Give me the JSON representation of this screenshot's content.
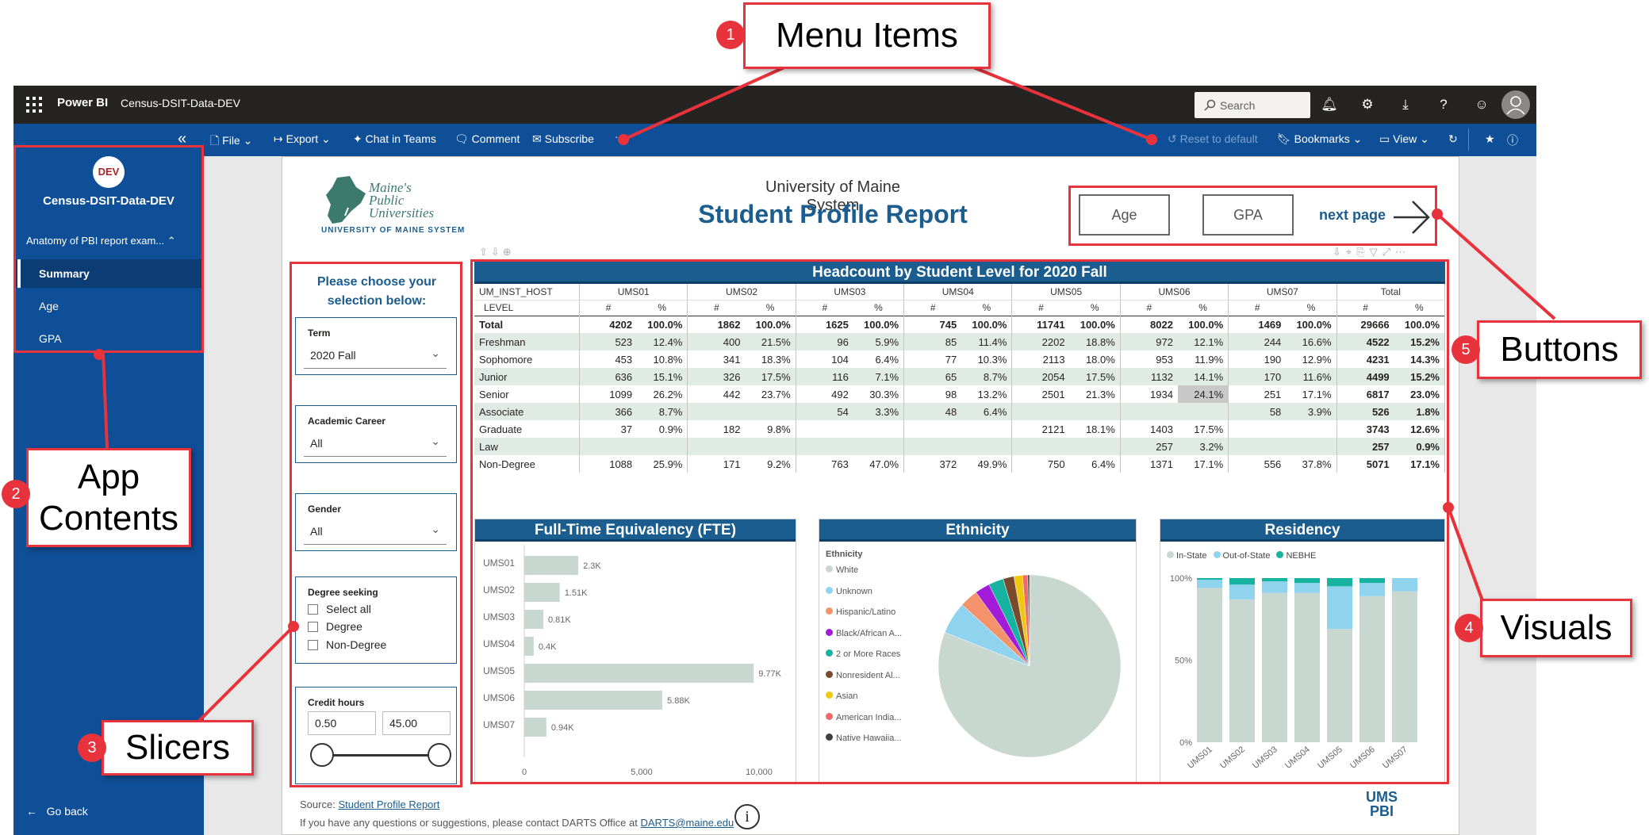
{
  "topbar": {
    "brand": "Power BI",
    "breadcrumb": "Census-DSIT-Data-DEV",
    "search_placeholder": "Search"
  },
  "commandbar": {
    "file": "File",
    "export": "Export",
    "chat_in_teams": "Chat in Teams",
    "comment": "Comment",
    "subscribe": "Subscribe",
    "more": "···",
    "reset": "Reset to default",
    "bookmarks": "Bookmarks",
    "view": "View"
  },
  "appnav": {
    "badge": "DEV",
    "title": "Census-DSIT-Data-DEV",
    "section": "Anatomy of PBI report exam...",
    "items": [
      "Summary",
      "Age",
      "GPA"
    ],
    "active": "Summary",
    "back": "Go back"
  },
  "report": {
    "logo_lines": [
      "Maine's",
      "Public",
      "Universities"
    ],
    "logo_sub": "UNIVERSITY OF MAINE SYSTEM",
    "subtitle": "University of Maine System",
    "title": "Student Profile Report",
    "buttons": {
      "age": "Age",
      "gpa": "GPA",
      "next": "next page"
    },
    "footer_source_label": "Source:",
    "footer_source_link": "Student Profile Report",
    "footer_contact": "If you have any questions or suggestions, please contact DARTS Office at",
    "footer_email": "DARTS@maine.edu",
    "corner_logo": [
      "UMS",
      "PBI"
    ]
  },
  "slicers": {
    "heading": "Please choose your selection below:",
    "term": {
      "label": "Term",
      "value": "2020 Fall"
    },
    "career": {
      "label": "Academic Career",
      "value": "All"
    },
    "gender": {
      "label": "Gender",
      "value": "All"
    },
    "degree": {
      "label": "Degree seeking",
      "options": [
        "Select all",
        "Degree",
        "Non-Degree"
      ]
    },
    "credit": {
      "label": "Credit hours",
      "min": "0.50",
      "max": "45.00"
    }
  },
  "matrix": {
    "title": "Headcount by Student Level for 2020 Fall",
    "corner_top": "UM_INST_HOST",
    "corner_bottom": "LEVEL",
    "groups": [
      "UMS01",
      "UMS02",
      "UMS03",
      "UMS04",
      "UMS05",
      "UMS06",
      "UMS07",
      "Total"
    ],
    "sub": [
      "#",
      "%"
    ],
    "rows": [
      {
        "level": "Total",
        "cells": [
          "4202",
          "100.0%",
          "1862",
          "100.0%",
          "1625",
          "100.0%",
          "745",
          "100.0%",
          "11741",
          "100.0%",
          "8022",
          "100.0%",
          "1469",
          "100.0%",
          "29666",
          "100.0%"
        ]
      },
      {
        "level": "Freshman",
        "cells": [
          "523",
          "12.4%",
          "400",
          "21.5%",
          "96",
          "5.9%",
          "85",
          "11.4%",
          "2202",
          "18.8%",
          "972",
          "12.1%",
          "244",
          "16.6%",
          "4522",
          "15.2%"
        ]
      },
      {
        "level": "Sophomore",
        "cells": [
          "453",
          "10.8%",
          "341",
          "18.3%",
          "104",
          "6.4%",
          "77",
          "10.3%",
          "2113",
          "18.0%",
          "953",
          "11.9%",
          "190",
          "12.9%",
          "4231",
          "14.3%"
        ]
      },
      {
        "level": "Junior",
        "cells": [
          "636",
          "15.1%",
          "326",
          "17.5%",
          "116",
          "7.1%",
          "65",
          "8.7%",
          "2054",
          "17.5%",
          "1132",
          "14.1%",
          "170",
          "11.6%",
          "4499",
          "15.2%"
        ]
      },
      {
        "level": "Senior",
        "cells": [
          "1099",
          "26.2%",
          "442",
          "23.7%",
          "492",
          "30.3%",
          "98",
          "13.2%",
          "2501",
          "21.3%",
          "1934",
          "24.1%",
          "251",
          "17.1%",
          "6817",
          "23.0%"
        ]
      },
      {
        "level": "Associate",
        "cells": [
          "366",
          "8.7%",
          "",
          "",
          "54",
          "3.3%",
          "48",
          "6.4%",
          "",
          "",
          "",
          "",
          "58",
          "3.9%",
          "526",
          "1.8%"
        ]
      },
      {
        "level": "Graduate",
        "cells": [
          "37",
          "0.9%",
          "182",
          "9.8%",
          "",
          "",
          "",
          "",
          "2121",
          "18.1%",
          "1403",
          "17.5%",
          "",
          "",
          "3743",
          "12.6%"
        ]
      },
      {
        "level": "Law",
        "cells": [
          "",
          "",
          "",
          "",
          "",
          "",
          "",
          "",
          "",
          "",
          "257",
          "3.2%",
          "",
          "",
          "257",
          "0.9%"
        ]
      },
      {
        "level": "Non-Degree",
        "cells": [
          "1088",
          "25.9%",
          "171",
          "9.2%",
          "763",
          "47.0%",
          "372",
          "49.9%",
          "750",
          "6.4%",
          "1371",
          "17.1%",
          "556",
          "37.8%",
          "5071",
          "17.1%"
        ]
      }
    ]
  },
  "chart_data": [
    {
      "type": "bar",
      "orientation": "horizontal",
      "title": "Full-Time Equivalency (FTE)",
      "categories": [
        "UMS01",
        "UMS02",
        "UMS03",
        "UMS04",
        "UMS05",
        "UMS06",
        "UMS07"
      ],
      "values": [
        2300,
        1510,
        810,
        400,
        9770,
        5880,
        940
      ],
      "data_labels": [
        "2.3K",
        "1.51K",
        "0.81K",
        "0.4K",
        "9.77K",
        "5.88K",
        "0.94K"
      ],
      "x_ticks": [
        "0",
        "5,000",
        "10,000"
      ],
      "xlim": [
        0,
        10000
      ],
      "bar_color": "#c9d7d1"
    },
    {
      "type": "pie",
      "title": "Ethnicity",
      "legend_title": "Ethnicity",
      "labels": [
        "White",
        "Unknown",
        "Hispanic/Latino",
        "Black/African A...",
        "2 or More Races",
        "Nonresident Al...",
        "Asian",
        "American India...",
        "Native Hawaiia..."
      ],
      "values": [
        79.5,
        5.6,
        3.2,
        2.6,
        2.6,
        1.9,
        1.5,
        0.9,
        0.3
      ],
      "colors": [
        "#c9d7d1",
        "#8fd3ef",
        "#f4926c",
        "#a21bd9",
        "#15b3a0",
        "#7a4a2d",
        "#f2c80f",
        "#f06a6a",
        "#404040"
      ]
    },
    {
      "type": "bar",
      "stacked": true,
      "percent": true,
      "title": "Residency",
      "categories": [
        "UMS01",
        "UMS02",
        "UMS03",
        "UMS04",
        "UMS05",
        "UMS06",
        "UMS07"
      ],
      "series": [
        {
          "name": "In-State",
          "values": [
            94,
            87,
            91,
            91,
            69,
            89,
            92
          ],
          "color": "#c9d7d1"
        },
        {
          "name": "Out-of-State",
          "values": [
            5,
            9,
            7,
            6,
            26,
            8,
            8
          ],
          "color": "#8fd3ef"
        },
        {
          "name": "NEBHE",
          "values": [
            1,
            4,
            2,
            3,
            5,
            3,
            0
          ],
          "color": "#15b3a0"
        }
      ],
      "y_ticks": [
        "100%",
        "50%",
        "0%"
      ],
      "ylim": [
        0,
        100
      ]
    }
  ],
  "annotations": {
    "menu": {
      "num": "1",
      "label": "Menu Items"
    },
    "app": {
      "num": "2",
      "label": "App Contents"
    },
    "slicers": {
      "num": "3",
      "label": "Slicers"
    },
    "visuals": {
      "num": "4",
      "label": "Visuals"
    },
    "buttons": {
      "num": "5",
      "label": "Buttons"
    }
  }
}
